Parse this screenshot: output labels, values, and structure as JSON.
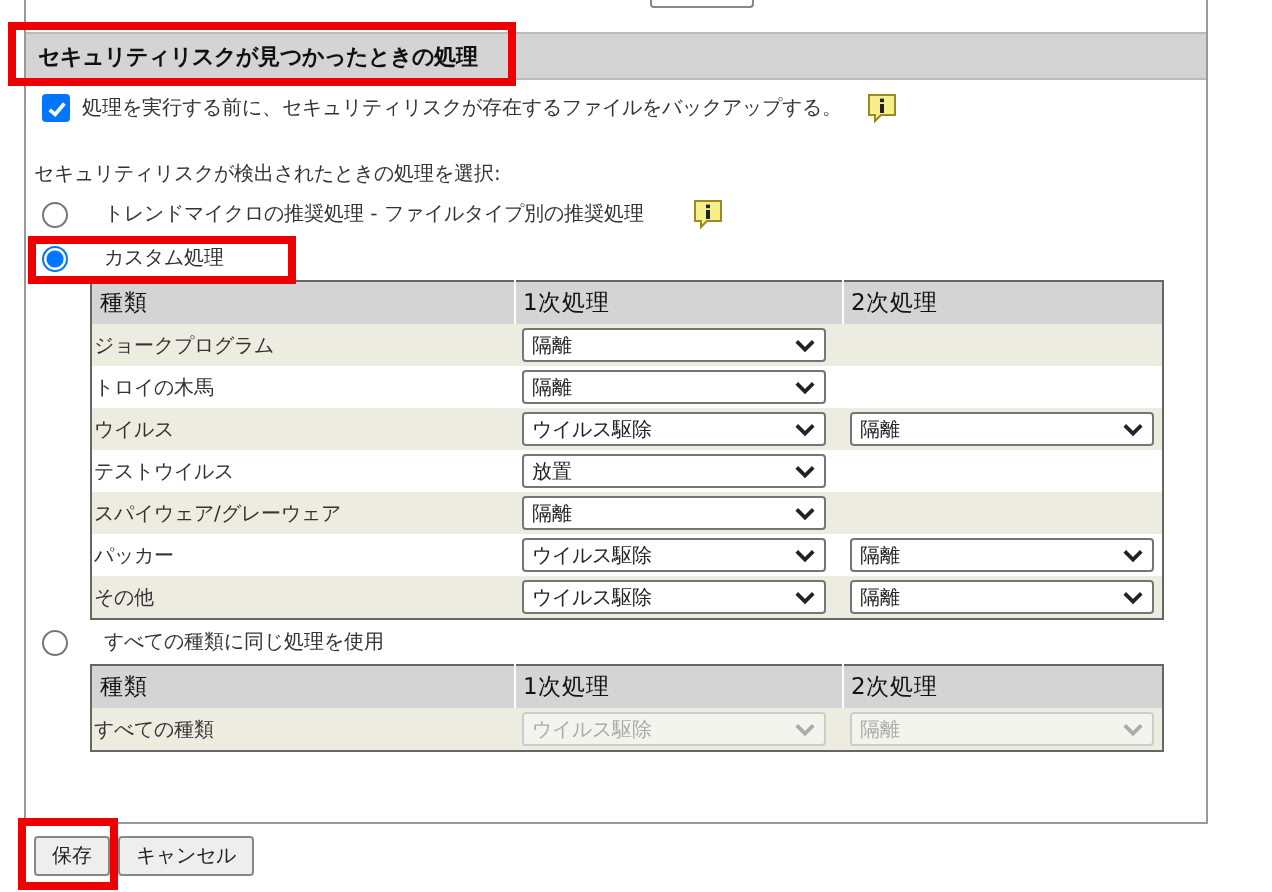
{
  "section": {
    "title": "セキュリティリスクが見つかったときの処理",
    "highlighted": true
  },
  "backup": {
    "label": "処理を実行する前に、セキュリティリスクが存在するファイルをバックアップする。",
    "checked": true,
    "info": true
  },
  "prompt": "セキュリティリスクが検出されたときの処理を選択:",
  "options": [
    {
      "label": "トレンドマイクロの推奨処理 - ファイルタイプ別の推奨処理",
      "selected": false,
      "info": true,
      "highlighted": false
    },
    {
      "label": "カスタム処理",
      "selected": true,
      "highlighted": true,
      "table": {
        "columns": [
          "種類",
          "1次処理",
          "2次処理"
        ],
        "rows": [
          {
            "type": "ジョークプログラム",
            "first": {
              "value": "隔離",
              "disabled": false
            }
          },
          {
            "type": "トロイの木馬",
            "first": {
              "value": "隔離",
              "disabled": false
            }
          },
          {
            "type": "ウイルス",
            "first": {
              "value": "ウイルス駆除",
              "disabled": false
            },
            "second": {
              "value": "隔離",
              "disabled": false
            }
          },
          {
            "type": "テストウイルス",
            "first": {
              "value": "放置",
              "disabled": false
            }
          },
          {
            "type": "スパイウェア/グレーウェア",
            "first": {
              "value": "隔離",
              "disabled": false
            }
          },
          {
            "type": "パッカー",
            "first": {
              "value": "ウイルス駆除",
              "disabled": false
            },
            "second": {
              "value": "隔離",
              "disabled": false
            }
          },
          {
            "type": "その他",
            "first": {
              "value": "ウイルス駆除",
              "disabled": false
            },
            "second": {
              "value": "隔離",
              "disabled": false
            }
          }
        ]
      }
    },
    {
      "label": "すべての種類に同じ処理を使用",
      "selected": false,
      "table": {
        "columns": [
          "種類",
          "1次処理",
          "2次処理"
        ],
        "rows": [
          {
            "type": "すべての種類",
            "first": {
              "value": "ウイルス駆除",
              "disabled": true
            },
            "second": {
              "value": "隔離",
              "disabled": true
            }
          }
        ]
      }
    }
  ],
  "buttons": [
    {
      "label": "保存",
      "highlighted": true
    },
    {
      "label": "キャンセル",
      "highlighted": false
    }
  ]
}
